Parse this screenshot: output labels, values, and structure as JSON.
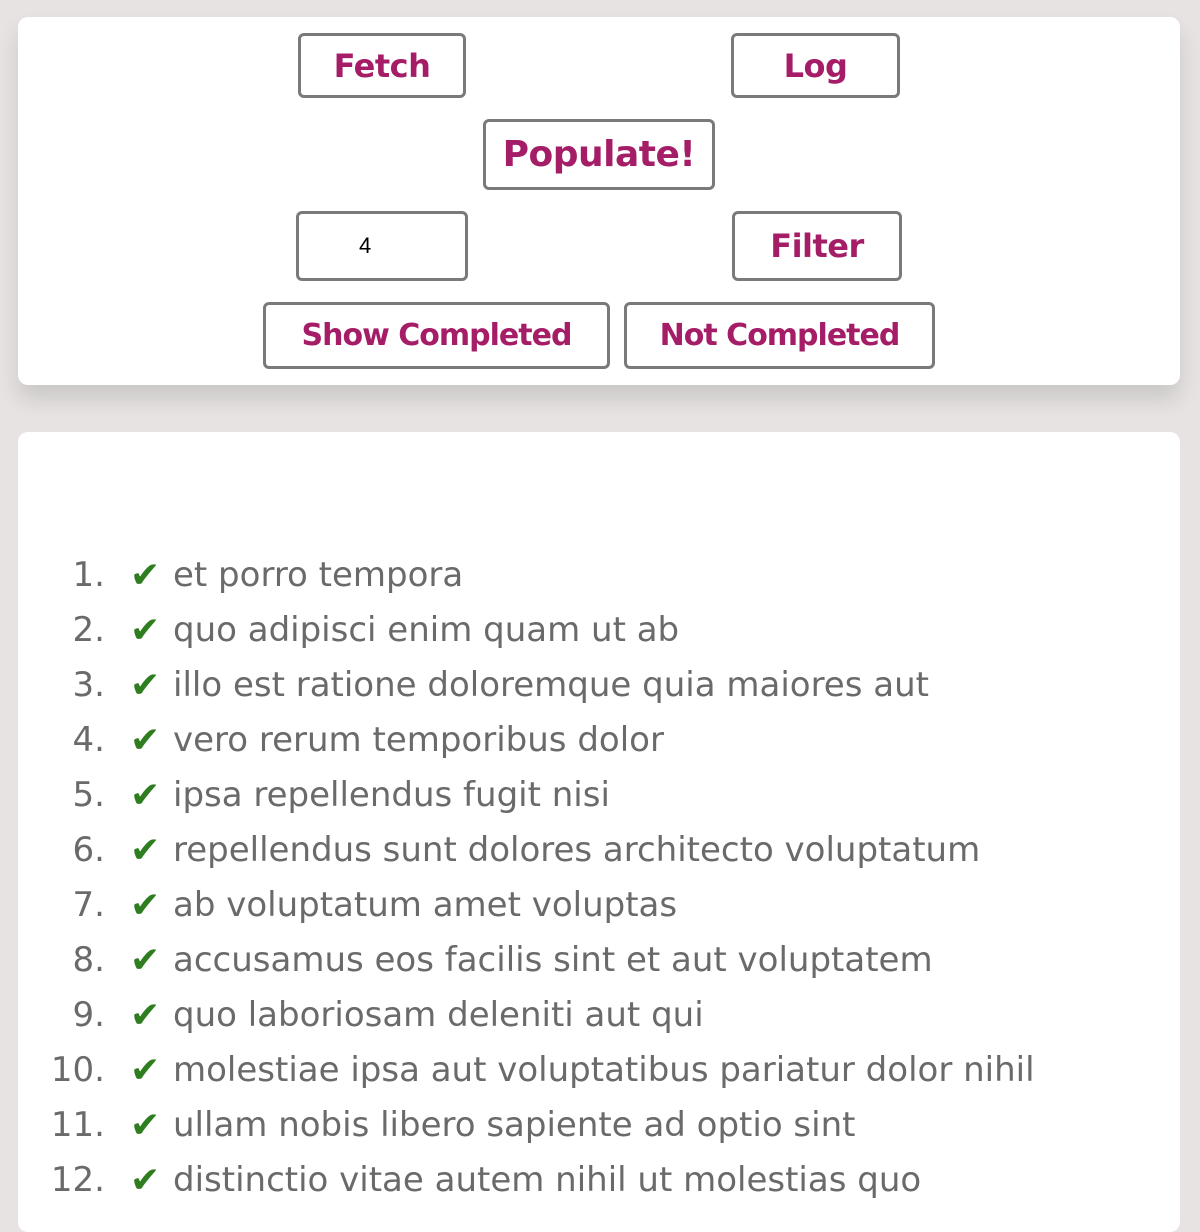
{
  "controls": {
    "fetch_label": "Fetch",
    "log_label": "Log",
    "populate_label": "Populate!",
    "filter_value": "4",
    "filter_label": "Filter",
    "show_completed_label": "Show Completed",
    "not_completed_label": "Not Completed"
  },
  "todos": [
    {
      "num": "1.",
      "check": "✔",
      "title": "et porro tempora"
    },
    {
      "num": "2.",
      "check": "✔",
      "title": "quo adipisci enim quam ut ab"
    },
    {
      "num": "3.",
      "check": "✔",
      "title": "illo est ratione doloremque quia maiores aut"
    },
    {
      "num": "4.",
      "check": "✔",
      "title": "vero rerum temporibus dolor"
    },
    {
      "num": "5.",
      "check": "✔",
      "title": "ipsa repellendus fugit nisi"
    },
    {
      "num": "6.",
      "check": "✔",
      "title": "repellendus sunt dolores architecto voluptatum"
    },
    {
      "num": "7.",
      "check": "✔",
      "title": "ab voluptatum amet voluptas"
    },
    {
      "num": "8.",
      "check": "✔",
      "title": "accusamus eos facilis sint et aut voluptatem"
    },
    {
      "num": "9.",
      "check": "✔",
      "title": "quo laboriosam deleniti aut qui"
    },
    {
      "num": "10.",
      "check": "✔",
      "title": "molestiae ipsa aut voluptatibus pariatur dolor nihil"
    },
    {
      "num": "11.",
      "check": "✔",
      "title": "ullam nobis libero sapiente ad optio sint"
    },
    {
      "num": "12.",
      "check": "✔",
      "title": "distinctio vitae autem nihil ut molestias quo"
    }
  ],
  "colors": {
    "background": "#e6e3e2",
    "button_text": "#a51d66",
    "button_border": "#7a7a7a",
    "check": "#2e7d1f",
    "list_text": "#6a6a6a"
  }
}
